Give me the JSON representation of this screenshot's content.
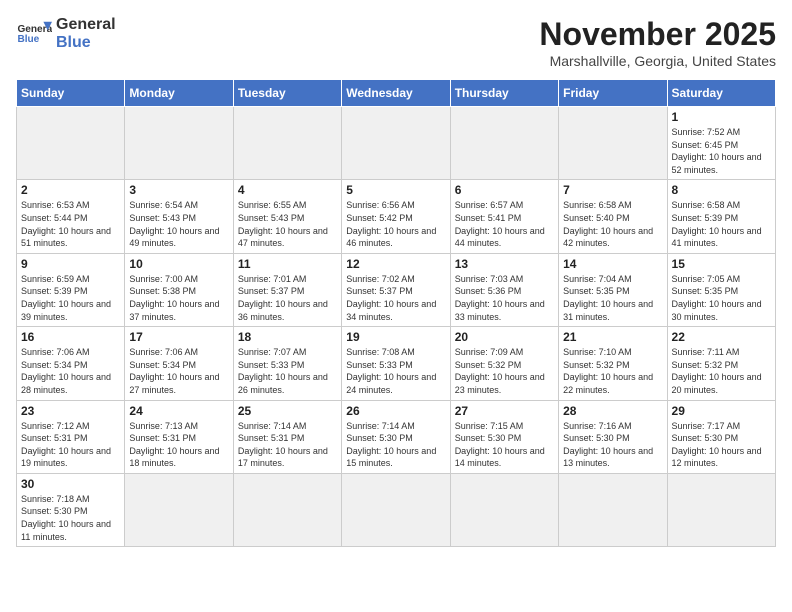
{
  "logo": {
    "line1": "General",
    "line2": "Blue"
  },
  "title": "November 2025",
  "subtitle": "Marshallville, Georgia, United States",
  "weekdays": [
    "Sunday",
    "Monday",
    "Tuesday",
    "Wednesday",
    "Thursday",
    "Friday",
    "Saturday"
  ],
  "weeks": [
    [
      {
        "day": "",
        "info": ""
      },
      {
        "day": "",
        "info": ""
      },
      {
        "day": "",
        "info": ""
      },
      {
        "day": "",
        "info": ""
      },
      {
        "day": "",
        "info": ""
      },
      {
        "day": "",
        "info": ""
      },
      {
        "day": "1",
        "info": "Sunrise: 7:52 AM\nSunset: 6:45 PM\nDaylight: 10 hours and 52 minutes."
      }
    ],
    [
      {
        "day": "2",
        "info": "Sunrise: 6:53 AM\nSunset: 5:44 PM\nDaylight: 10 hours and 51 minutes."
      },
      {
        "day": "3",
        "info": "Sunrise: 6:54 AM\nSunset: 5:43 PM\nDaylight: 10 hours and 49 minutes."
      },
      {
        "day": "4",
        "info": "Sunrise: 6:55 AM\nSunset: 5:43 PM\nDaylight: 10 hours and 47 minutes."
      },
      {
        "day": "5",
        "info": "Sunrise: 6:56 AM\nSunset: 5:42 PM\nDaylight: 10 hours and 46 minutes."
      },
      {
        "day": "6",
        "info": "Sunrise: 6:57 AM\nSunset: 5:41 PM\nDaylight: 10 hours and 44 minutes."
      },
      {
        "day": "7",
        "info": "Sunrise: 6:58 AM\nSunset: 5:40 PM\nDaylight: 10 hours and 42 minutes."
      },
      {
        "day": "8",
        "info": "Sunrise: 6:58 AM\nSunset: 5:39 PM\nDaylight: 10 hours and 41 minutes."
      }
    ],
    [
      {
        "day": "9",
        "info": "Sunrise: 6:59 AM\nSunset: 5:39 PM\nDaylight: 10 hours and 39 minutes."
      },
      {
        "day": "10",
        "info": "Sunrise: 7:00 AM\nSunset: 5:38 PM\nDaylight: 10 hours and 37 minutes."
      },
      {
        "day": "11",
        "info": "Sunrise: 7:01 AM\nSunset: 5:37 PM\nDaylight: 10 hours and 36 minutes."
      },
      {
        "day": "12",
        "info": "Sunrise: 7:02 AM\nSunset: 5:37 PM\nDaylight: 10 hours and 34 minutes."
      },
      {
        "day": "13",
        "info": "Sunrise: 7:03 AM\nSunset: 5:36 PM\nDaylight: 10 hours and 33 minutes."
      },
      {
        "day": "14",
        "info": "Sunrise: 7:04 AM\nSunset: 5:35 PM\nDaylight: 10 hours and 31 minutes."
      },
      {
        "day": "15",
        "info": "Sunrise: 7:05 AM\nSunset: 5:35 PM\nDaylight: 10 hours and 30 minutes."
      }
    ],
    [
      {
        "day": "16",
        "info": "Sunrise: 7:06 AM\nSunset: 5:34 PM\nDaylight: 10 hours and 28 minutes."
      },
      {
        "day": "17",
        "info": "Sunrise: 7:06 AM\nSunset: 5:34 PM\nDaylight: 10 hours and 27 minutes."
      },
      {
        "day": "18",
        "info": "Sunrise: 7:07 AM\nSunset: 5:33 PM\nDaylight: 10 hours and 26 minutes."
      },
      {
        "day": "19",
        "info": "Sunrise: 7:08 AM\nSunset: 5:33 PM\nDaylight: 10 hours and 24 minutes."
      },
      {
        "day": "20",
        "info": "Sunrise: 7:09 AM\nSunset: 5:32 PM\nDaylight: 10 hours and 23 minutes."
      },
      {
        "day": "21",
        "info": "Sunrise: 7:10 AM\nSunset: 5:32 PM\nDaylight: 10 hours and 22 minutes."
      },
      {
        "day": "22",
        "info": "Sunrise: 7:11 AM\nSunset: 5:32 PM\nDaylight: 10 hours and 20 minutes."
      }
    ],
    [
      {
        "day": "23",
        "info": "Sunrise: 7:12 AM\nSunset: 5:31 PM\nDaylight: 10 hours and 19 minutes."
      },
      {
        "day": "24",
        "info": "Sunrise: 7:13 AM\nSunset: 5:31 PM\nDaylight: 10 hours and 18 minutes."
      },
      {
        "day": "25",
        "info": "Sunrise: 7:14 AM\nSunset: 5:31 PM\nDaylight: 10 hours and 17 minutes."
      },
      {
        "day": "26",
        "info": "Sunrise: 7:14 AM\nSunset: 5:30 PM\nDaylight: 10 hours and 15 minutes."
      },
      {
        "day": "27",
        "info": "Sunrise: 7:15 AM\nSunset: 5:30 PM\nDaylight: 10 hours and 14 minutes."
      },
      {
        "day": "28",
        "info": "Sunrise: 7:16 AM\nSunset: 5:30 PM\nDaylight: 10 hours and 13 minutes."
      },
      {
        "day": "29",
        "info": "Sunrise: 7:17 AM\nSunset: 5:30 PM\nDaylight: 10 hours and 12 minutes."
      }
    ],
    [
      {
        "day": "30",
        "info": "Sunrise: 7:18 AM\nSunset: 5:30 PM\nDaylight: 10 hours and 11 minutes."
      },
      {
        "day": "",
        "info": ""
      },
      {
        "day": "",
        "info": ""
      },
      {
        "day": "",
        "info": ""
      },
      {
        "day": "",
        "info": ""
      },
      {
        "day": "",
        "info": ""
      },
      {
        "day": "",
        "info": ""
      }
    ]
  ]
}
